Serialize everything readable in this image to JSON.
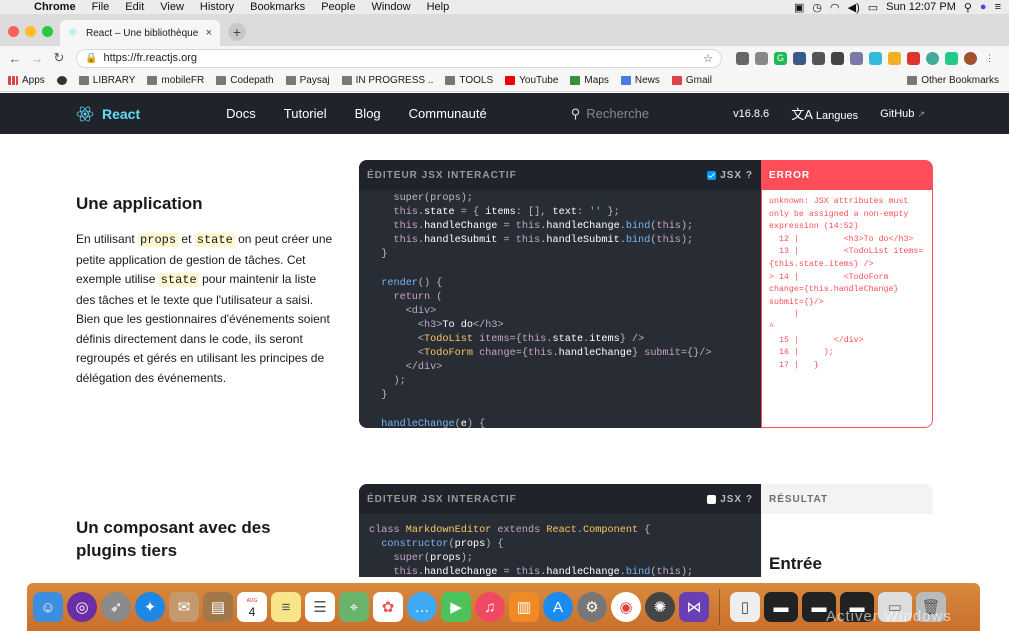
{
  "menubar": {
    "app": "Chrome",
    "items": [
      "File",
      "Edit",
      "View",
      "History",
      "Bookmarks",
      "People",
      "Window",
      "Help"
    ],
    "clock": "Sun 12:07 PM"
  },
  "tab": {
    "title": "React – Une bibliothèque Javas",
    "close": "×",
    "new": "+"
  },
  "address": {
    "url": "https://fr.reactjs.org"
  },
  "bookmarks": {
    "items": [
      "Apps",
      "LIBRARY",
      "mobileFR",
      "Codepath",
      "Paysaj",
      "IN PROGRESS ..",
      "TOOLS",
      "YouTube",
      "Maps",
      "News",
      "Gmail"
    ],
    "other": "Other Bookmarks"
  },
  "nav": {
    "brand": "React",
    "links": [
      "Docs",
      "Tutoriel",
      "Blog",
      "Communauté"
    ],
    "search_placeholder": "Recherche",
    "version": "v16.8.6",
    "languages": "Langues",
    "github": "GitHub"
  },
  "section1": {
    "title": "Une application",
    "p_1": "En utilisant",
    "code_props": "props",
    "p_2": "et",
    "code_state": "state",
    "p_3": "on peut créer une petite application de gestion de tâches. Cet exemple utilise",
    "code_state2": "state",
    "p_4": "pour maintenir la liste des tâches et le texte que l'utilisateur a saisi. Bien que les gestionnaires d'événements soient définis directement dans le code, ils seront regroupés et gérés en utilisant les principes de délégation des événements."
  },
  "editor1": {
    "header": "ÉDITEUR JSX INTERACTIF",
    "jsx_label": "JSX ?",
    "error_header": "ERROR",
    "error_text": "unknown: JSX attributes must only be assigned a non-empty expression (14:52)\n  12 |         <h3>To do</h3>\n  13 |         <TodoList items={this.state.items} />\n> 14 |         <TodoForm change={this.handleChange} submit={}/>\n     |                                                    ^\n  15 |       </div>\n  16 |     );\n  17 |   }"
  },
  "section2": {
    "title": "Un composant avec des plugins tiers"
  },
  "editor2": {
    "header": "ÉDITEUR JSX INTERACTIF",
    "jsx_label": "JSX ?",
    "result_header": "RÉSULTAT",
    "result_heading": "Entrée"
  },
  "dock": {
    "calendar_day": "4",
    "calendar_month": "AUG",
    "watermark": "Activer Windows"
  },
  "colors": {
    "react_blue": "#61dafb",
    "nav_dark": "#20232a",
    "editor_bg": "#282c34",
    "error_red": "#ff4e59"
  }
}
